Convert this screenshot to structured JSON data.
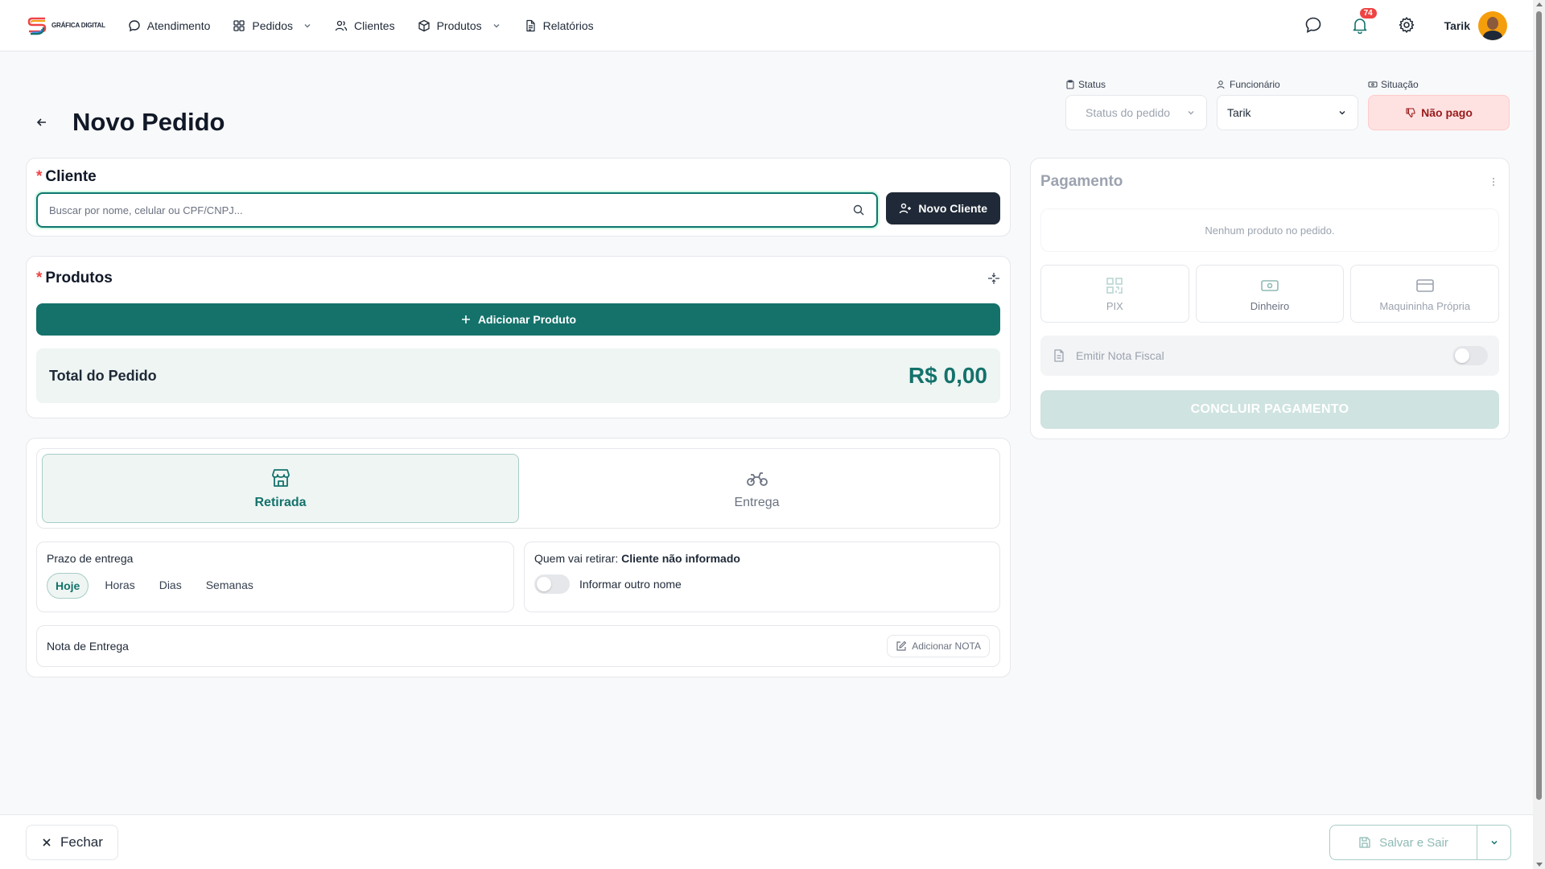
{
  "header": {
    "logo_text": "GRÁFICA DIGITAL",
    "nav": {
      "atendimento": "Atendimento",
      "pedidos": "Pedidos",
      "clientes": "Clientes",
      "produtos": "Produtos",
      "relatorios": "Relatórios"
    },
    "notification_count": "74",
    "user_name": "Tarik"
  },
  "page": {
    "title": "Novo Pedido"
  },
  "filters": {
    "status_label": "Status",
    "status_placeholder": "Status do pedido",
    "employee_label": "Funcionário",
    "employee_value": "Tarik",
    "situation_label": "Situação",
    "situation_value": "Não pago"
  },
  "client": {
    "title": "Cliente",
    "required_mark": "*",
    "search_placeholder": "Buscar por nome, celular ou CPF/CNPJ...",
    "new_client_label": "Novo Cliente"
  },
  "products": {
    "title": "Produtos",
    "required_mark": "*",
    "add_label": "Adicionar Produto",
    "total_label": "Total do Pedido",
    "total_value": "R$ 0,00"
  },
  "delivery": {
    "modes": {
      "pickup": "Retirada",
      "delivery": "Entrega"
    },
    "active_mode": "Retirada",
    "deadline_label": "Prazo de entrega",
    "deadline_options": {
      "today": "Hoje",
      "hours": "Horas",
      "days": "Dias",
      "weeks": "Semanas"
    },
    "who_label": "Quem vai retirar:",
    "who_value": "Cliente não informado",
    "other_name_label": "Informar outro nome",
    "note_label": "Nota de Entrega",
    "add_note_label": "Adicionar NOTA"
  },
  "payment": {
    "title": "Pagamento",
    "empty_text": "Nenhum produto no pedido.",
    "methods": {
      "pix": "PIX",
      "cash": "Dinheiro",
      "machine": "Maquininha Própria"
    },
    "invoice_label": "Emitir Nota Fiscal",
    "finish_label": "CONCLUIR PAGAMENTO"
  },
  "footer": {
    "close_label": "Fechar",
    "save_label": "Salvar e Sair"
  },
  "colors": {
    "primary": "#14726b",
    "dark": "#1f2937",
    "danger": "#ef4444"
  }
}
